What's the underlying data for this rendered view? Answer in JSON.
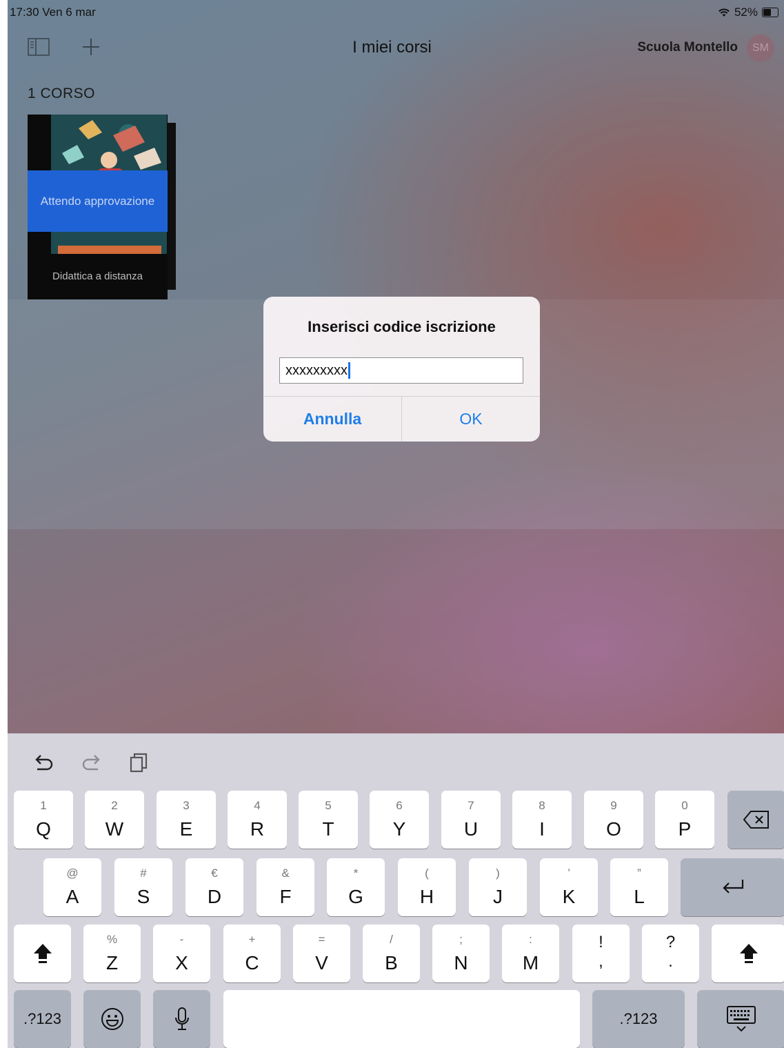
{
  "status_bar": {
    "time_date": "17:30  Ven 6 mar",
    "battery": "52%",
    "battery_level": 0.52
  },
  "nav": {
    "title": "I miei corsi",
    "school": "Scuola Montello",
    "avatar_initials": "SM"
  },
  "courses": {
    "count_label": "1 CORSO",
    "items": [
      {
        "status": "Attendo approvazione",
        "title": "Didattica a distanza"
      }
    ]
  },
  "dialog": {
    "title": "Inserisci codice iscrizione",
    "input_value": "xxxxxxxxx",
    "cancel_label": "Annulla",
    "ok_label": "OK"
  },
  "keyboard": {
    "row1": [
      {
        "main": "Q",
        "sub": "1"
      },
      {
        "main": "W",
        "sub": "2"
      },
      {
        "main": "E",
        "sub": "3"
      },
      {
        "main": "R",
        "sub": "4"
      },
      {
        "main": "T",
        "sub": "5"
      },
      {
        "main": "Y",
        "sub": "6"
      },
      {
        "main": "U",
        "sub": "7"
      },
      {
        "main": "I",
        "sub": "8"
      },
      {
        "main": "O",
        "sub": "9"
      },
      {
        "main": "P",
        "sub": "0"
      }
    ],
    "row2": [
      {
        "main": "A",
        "sub": "@"
      },
      {
        "main": "S",
        "sub": "#"
      },
      {
        "main": "D",
        "sub": "€"
      },
      {
        "main": "F",
        "sub": "&"
      },
      {
        "main": "G",
        "sub": "*"
      },
      {
        "main": "H",
        "sub": "("
      },
      {
        "main": "J",
        "sub": ")"
      },
      {
        "main": "K",
        "sub": "’"
      },
      {
        "main": "L",
        "sub": "”"
      }
    ],
    "row3": [
      {
        "main": "Z",
        "sub": "%"
      },
      {
        "main": "X",
        "sub": "-"
      },
      {
        "main": "C",
        "sub": "+"
      },
      {
        "main": "V",
        "sub": "="
      },
      {
        "main": "B",
        "sub": "/"
      },
      {
        "main": "N",
        "sub": ";"
      },
      {
        "main": "M",
        "sub": ":"
      }
    ],
    "punct": [
      {
        "top": "!",
        "bottom": ","
      },
      {
        "top": "?",
        "bottom": "."
      }
    ],
    "numbers_key_label": ".?123"
  },
  "colors": {
    "accent": "#1e7ee8",
    "banner": "#1f62d6",
    "keyboard_bg": "#d5d3dc"
  }
}
